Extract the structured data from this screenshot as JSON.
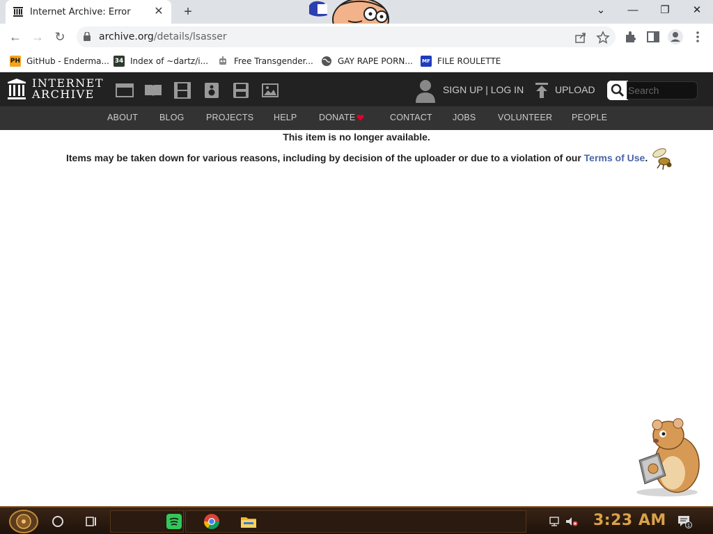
{
  "browser": {
    "tab_title": "Internet Archive: Error",
    "tab_close": "✕",
    "new_tab": "+",
    "window_controls": {
      "chevron": "⌄",
      "minimize": "—",
      "restore": "❐",
      "close": "✕"
    },
    "nav": {
      "back": "←",
      "forward": "→",
      "reload": "↻"
    },
    "url_host": "archive.org",
    "url_path": "/details/lsasser",
    "toolbar_icons": [
      "share-icon",
      "star-icon",
      "extensions-icon",
      "side-panel-icon",
      "profile-icon",
      "menu-icon"
    ]
  },
  "bookmarks": [
    {
      "label": "GitHub - Enderma...",
      "icon_text": "PH",
      "icon_color": "#f7a21b",
      "icon": "ph-icon"
    },
    {
      "label": "Index of ~dartz/i...",
      "icon_text": "34",
      "icon_color": "#2d3a2d",
      "icon": "dartz-icon"
    },
    {
      "label": "Free Transgender...",
      "icon_text": "",
      "icon_color": "#888888",
      "icon": "robot-icon"
    },
    {
      "label": "GAY RAPE PORN...",
      "icon_text": "",
      "icon_color": "#555555",
      "icon": "globe-icon"
    },
    {
      "label": "FILE ROULETTE",
      "icon_text": "MF",
      "icon_color": "#1d3bbd",
      "icon": "file-roulette-icon"
    }
  ],
  "ia_header": {
    "logo_line1": "INTERNET",
    "logo_line2": "ARCHIVE",
    "media_icons": [
      "web-icon",
      "texts-icon",
      "video-icon",
      "audio-icon",
      "software-icon",
      "images-icon"
    ],
    "signup_login": "SIGN UP | LOG IN",
    "upload": "UPLOAD",
    "search_placeholder": "Search"
  },
  "ia_nav": [
    "ABOUT",
    "BLOG",
    "PROJECTS",
    "HELP",
    "DONATE",
    "CONTACT",
    "JOBS",
    "VOLUNTEER",
    "PEOPLE"
  ],
  "content": {
    "title": "This item is no longer available.",
    "body_before": "Items may be taken down for various reasons, including by decision of the uploader or due to a violation of our ",
    "body_link": "Terms of Use",
    "body_after": "."
  },
  "taskbar": {
    "clock": "3:23 AM",
    "apps": [
      "spotify-icon",
      "chrome-icon",
      "file-explorer-icon"
    ],
    "notification_count": "1"
  },
  "colors": {
    "ia_header_bg": "#222222",
    "ia_nav_bg": "#333333",
    "link": "#4b64a8",
    "clock": "#d9a24a"
  }
}
